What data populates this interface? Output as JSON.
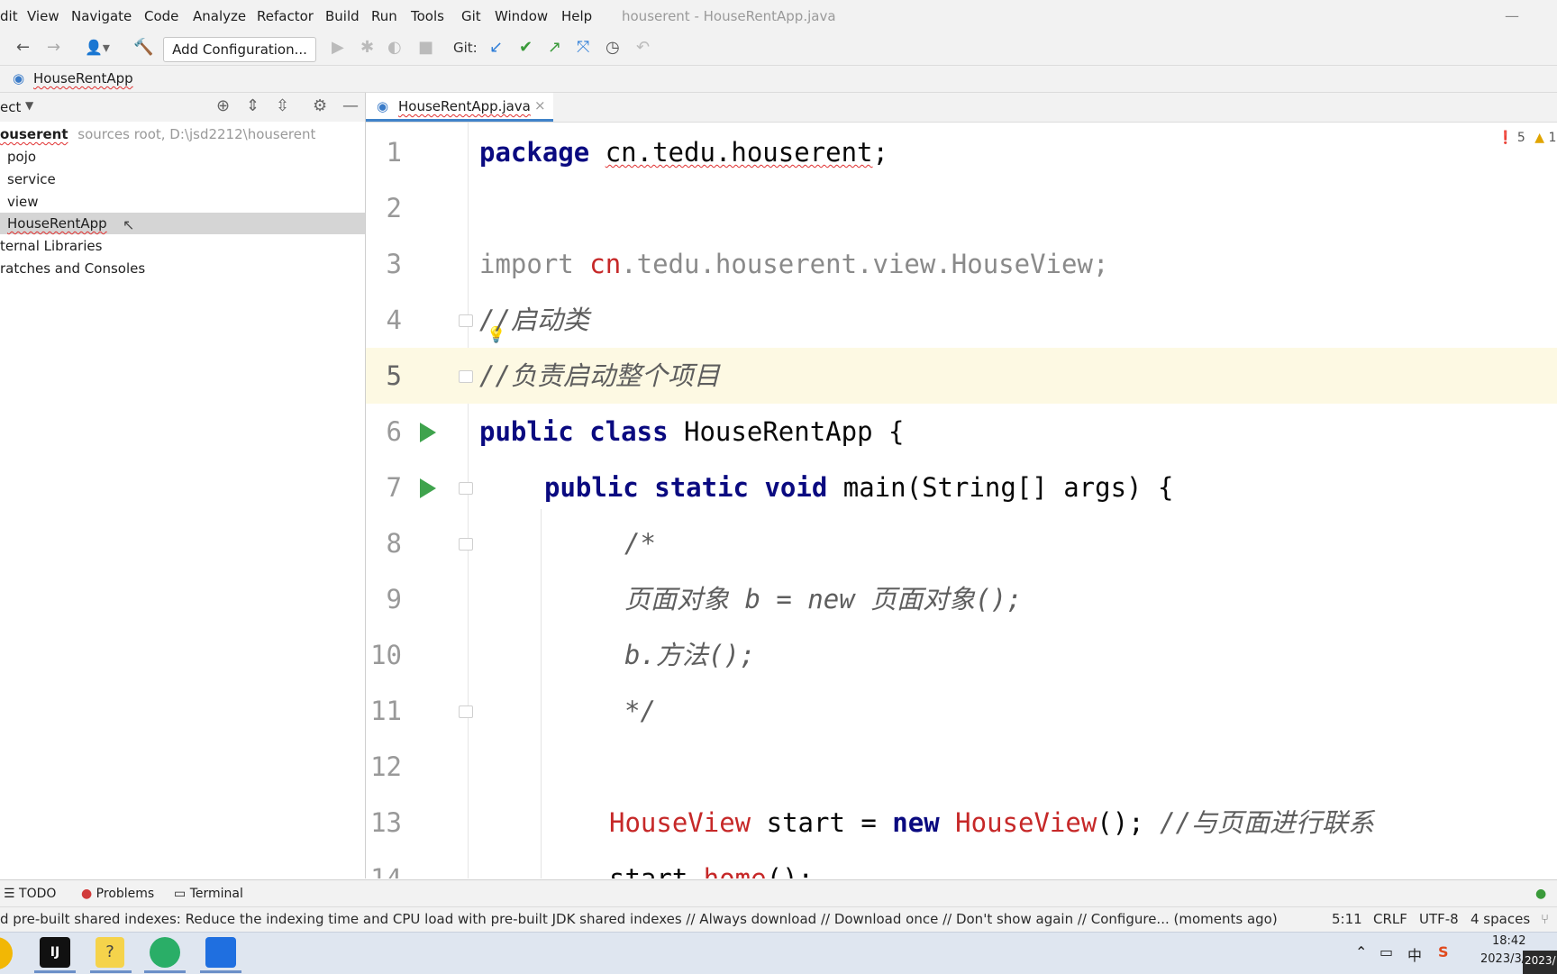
{
  "window": {
    "title": "houserent - HouseRentApp.java"
  },
  "menu": [
    "dit",
    "View",
    "Navigate",
    "Code",
    "Analyze",
    "Refactor",
    "Build",
    "Run",
    "Tools",
    "Git",
    "Window",
    "Help"
  ],
  "toolbar": {
    "add_configuration": "Add Configuration...",
    "git_label": "Git:"
  },
  "breadcrumb": {
    "file": "HouseRentApp"
  },
  "project_panel": {
    "title": "ect",
    "root_name": "ouserent",
    "root_hint": "sources root,  D:\\jsd2212\\houserent",
    "items": [
      "pojo",
      "service",
      "view",
      "HouseRentApp"
    ],
    "external": "ternal Libraries",
    "scratches": "ratches and Consoles"
  },
  "editor": {
    "tab_label": "HouseRentApp.java",
    "tab_close": "×",
    "inspections": {
      "errors": "5",
      "warnings": "1"
    },
    "line_numbers": [
      "1",
      "2",
      "3",
      "4",
      "5",
      "6",
      "7",
      "8",
      "9",
      "10",
      "11",
      "12",
      "13",
      "14"
    ],
    "lines": {
      "l1_kw": "package",
      "l1_pkg": "cn.tedu.houserent",
      "l1_end": ";",
      "l3_kw": "import",
      "l3_cn": "cn",
      "l3_rest": ".tedu.houserent.view.HouseView;",
      "l4": "//启动类",
      "l5": "//负责启动整个项目",
      "l6_public": "public",
      "l6_class": "class",
      "l6_rest": "HouseRentApp {",
      "l7_public": "public",
      "l7_static": "static",
      "l7_void": "void",
      "l7_rest": "main(String[] args) {",
      "l8": "/*",
      "l9": "页面对象 b = new 页面对象();",
      "l10": "b.方法();",
      "l11": "*/",
      "l13_type": "HouseView",
      "l13_mid": "start = ",
      "l13_new": "new",
      "l13_ctor": "HouseView",
      "l13_end": "(); ",
      "l13_cmt": "//与页面进行联系",
      "l14_a": "start.",
      "l14_b": "home",
      "l14_c": "();"
    }
  },
  "tool_windows": {
    "todo": "TODO",
    "problems": "Problems",
    "terminal": "Terminal"
  },
  "status": {
    "message": "d pre-built shared indexes: Reduce the indexing time and CPU load with pre-built JDK shared indexes // Always download // Download once // Don't show again // Configure... (moments ago)",
    "position": "5:11",
    "line_sep": "CRLF",
    "encoding": "UTF-8",
    "indent": "4 spaces"
  },
  "taskbar": {
    "ime": "中",
    "time": "18:42",
    "date": "2023/3/",
    "date_overlay": "2023/"
  },
  "colors": {
    "run_green": "#3fa34d",
    "error_red": "#c62828",
    "keyword_blue": "#0033b3",
    "caret_row": "#fdf9e3"
  }
}
